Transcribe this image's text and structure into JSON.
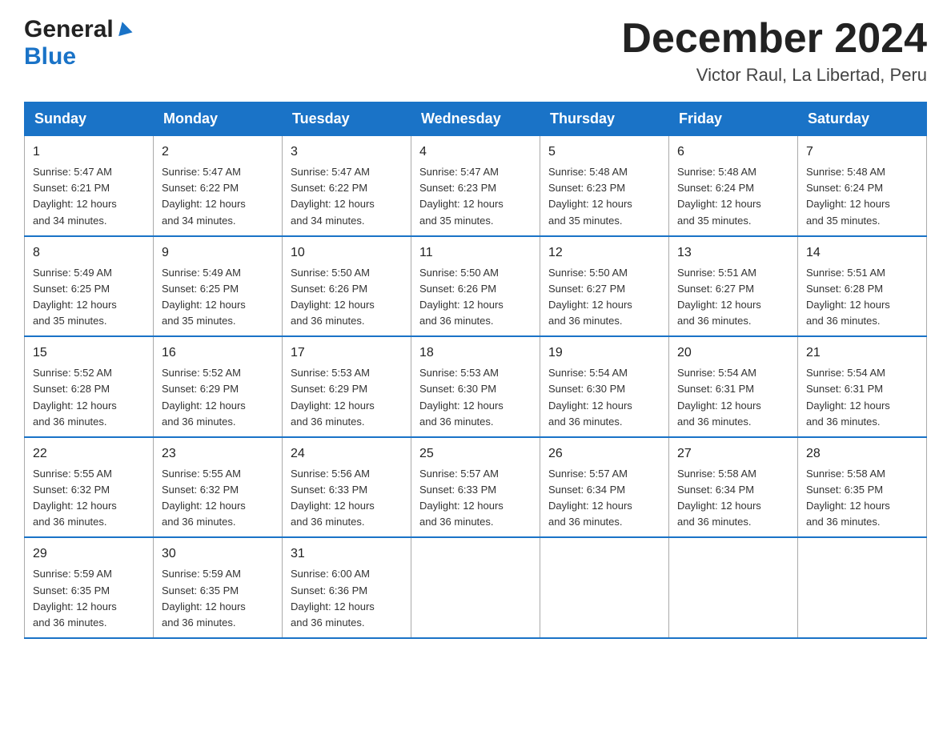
{
  "header": {
    "logo_general": "General",
    "logo_blue": "Blue",
    "main_title": "December 2024",
    "subtitle": "Victor Raul, La Libertad, Peru"
  },
  "days_of_week": [
    "Sunday",
    "Monday",
    "Tuesday",
    "Wednesday",
    "Thursday",
    "Friday",
    "Saturday"
  ],
  "weeks": [
    [
      {
        "date": "1",
        "sunrise": "5:47 AM",
        "sunset": "6:21 PM",
        "daylight": "12 hours and 34 minutes."
      },
      {
        "date": "2",
        "sunrise": "5:47 AM",
        "sunset": "6:22 PM",
        "daylight": "12 hours and 34 minutes."
      },
      {
        "date": "3",
        "sunrise": "5:47 AM",
        "sunset": "6:22 PM",
        "daylight": "12 hours and 34 minutes."
      },
      {
        "date": "4",
        "sunrise": "5:47 AM",
        "sunset": "6:23 PM",
        "daylight": "12 hours and 35 minutes."
      },
      {
        "date": "5",
        "sunrise": "5:48 AM",
        "sunset": "6:23 PM",
        "daylight": "12 hours and 35 minutes."
      },
      {
        "date": "6",
        "sunrise": "5:48 AM",
        "sunset": "6:24 PM",
        "daylight": "12 hours and 35 minutes."
      },
      {
        "date": "7",
        "sunrise": "5:48 AM",
        "sunset": "6:24 PM",
        "daylight": "12 hours and 35 minutes."
      }
    ],
    [
      {
        "date": "8",
        "sunrise": "5:49 AM",
        "sunset": "6:25 PM",
        "daylight": "12 hours and 35 minutes."
      },
      {
        "date": "9",
        "sunrise": "5:49 AM",
        "sunset": "6:25 PM",
        "daylight": "12 hours and 35 minutes."
      },
      {
        "date": "10",
        "sunrise": "5:50 AM",
        "sunset": "6:26 PM",
        "daylight": "12 hours and 36 minutes."
      },
      {
        "date": "11",
        "sunrise": "5:50 AM",
        "sunset": "6:26 PM",
        "daylight": "12 hours and 36 minutes."
      },
      {
        "date": "12",
        "sunrise": "5:50 AM",
        "sunset": "6:27 PM",
        "daylight": "12 hours and 36 minutes."
      },
      {
        "date": "13",
        "sunrise": "5:51 AM",
        "sunset": "6:27 PM",
        "daylight": "12 hours and 36 minutes."
      },
      {
        "date": "14",
        "sunrise": "5:51 AM",
        "sunset": "6:28 PM",
        "daylight": "12 hours and 36 minutes."
      }
    ],
    [
      {
        "date": "15",
        "sunrise": "5:52 AM",
        "sunset": "6:28 PM",
        "daylight": "12 hours and 36 minutes."
      },
      {
        "date": "16",
        "sunrise": "5:52 AM",
        "sunset": "6:29 PM",
        "daylight": "12 hours and 36 minutes."
      },
      {
        "date": "17",
        "sunrise": "5:53 AM",
        "sunset": "6:29 PM",
        "daylight": "12 hours and 36 minutes."
      },
      {
        "date": "18",
        "sunrise": "5:53 AM",
        "sunset": "6:30 PM",
        "daylight": "12 hours and 36 minutes."
      },
      {
        "date": "19",
        "sunrise": "5:54 AM",
        "sunset": "6:30 PM",
        "daylight": "12 hours and 36 minutes."
      },
      {
        "date": "20",
        "sunrise": "5:54 AM",
        "sunset": "6:31 PM",
        "daylight": "12 hours and 36 minutes."
      },
      {
        "date": "21",
        "sunrise": "5:54 AM",
        "sunset": "6:31 PM",
        "daylight": "12 hours and 36 minutes."
      }
    ],
    [
      {
        "date": "22",
        "sunrise": "5:55 AM",
        "sunset": "6:32 PM",
        "daylight": "12 hours and 36 minutes."
      },
      {
        "date": "23",
        "sunrise": "5:55 AM",
        "sunset": "6:32 PM",
        "daylight": "12 hours and 36 minutes."
      },
      {
        "date": "24",
        "sunrise": "5:56 AM",
        "sunset": "6:33 PM",
        "daylight": "12 hours and 36 minutes."
      },
      {
        "date": "25",
        "sunrise": "5:57 AM",
        "sunset": "6:33 PM",
        "daylight": "12 hours and 36 minutes."
      },
      {
        "date": "26",
        "sunrise": "5:57 AM",
        "sunset": "6:34 PM",
        "daylight": "12 hours and 36 minutes."
      },
      {
        "date": "27",
        "sunrise": "5:58 AM",
        "sunset": "6:34 PM",
        "daylight": "12 hours and 36 minutes."
      },
      {
        "date": "28",
        "sunrise": "5:58 AM",
        "sunset": "6:35 PM",
        "daylight": "12 hours and 36 minutes."
      }
    ],
    [
      {
        "date": "29",
        "sunrise": "5:59 AM",
        "sunset": "6:35 PM",
        "daylight": "12 hours and 36 minutes."
      },
      {
        "date": "30",
        "sunrise": "5:59 AM",
        "sunset": "6:35 PM",
        "daylight": "12 hours and 36 minutes."
      },
      {
        "date": "31",
        "sunrise": "6:00 AM",
        "sunset": "6:36 PM",
        "daylight": "12 hours and 36 minutes."
      },
      null,
      null,
      null,
      null
    ]
  ],
  "labels": {
    "sunrise_prefix": "Sunrise: ",
    "sunset_prefix": "Sunset: ",
    "daylight_prefix": "Daylight: "
  }
}
